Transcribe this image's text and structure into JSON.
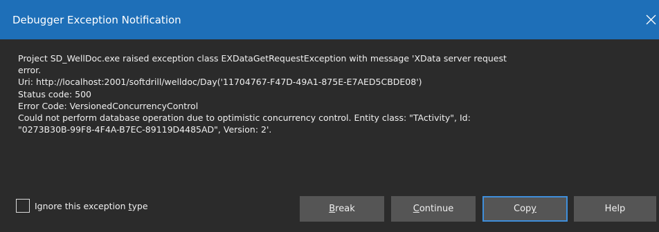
{
  "window": {
    "title": "Debugger Exception Notification"
  },
  "message": {
    "lines": [
      "Project SD_WellDoc.exe raised exception class EXDataGetRequestException with message 'XData server request",
      "error.",
      "Uri: http://localhost:2001/softdrill/welldoc/Day('11704767-F47D-49A1-875E-E7AED5CBDE08')",
      "Status code: 500",
      "Error Code: VersionedConcurrencyControl",
      "Could not perform database operation due to optimistic concurrency control. Entity class: \"TActivity\", Id:",
      "\"0273B30B-99F8-4F4A-B7EC-89119D4485AD\", Version: 2'."
    ]
  },
  "ignore_checkbox": {
    "label_prefix": "Ignore this exception ",
    "label_mnemonic": "t",
    "label_suffix": "ype",
    "checked": false
  },
  "buttons": {
    "break": {
      "mnemonic": "B",
      "rest": "reak"
    },
    "continue": {
      "mnemonic": "C",
      "rest": "ontinue"
    },
    "copy": {
      "prefix": "Cop",
      "mnemonic": "y"
    },
    "help": {
      "label": "Help"
    }
  },
  "colors": {
    "titlebar": "#1e6fb8",
    "background": "#2b2b2b",
    "button": "#555555",
    "focus_border": "#3f8fdc",
    "text": "#f0f0f0"
  },
  "icons": {
    "close": "close-icon"
  }
}
